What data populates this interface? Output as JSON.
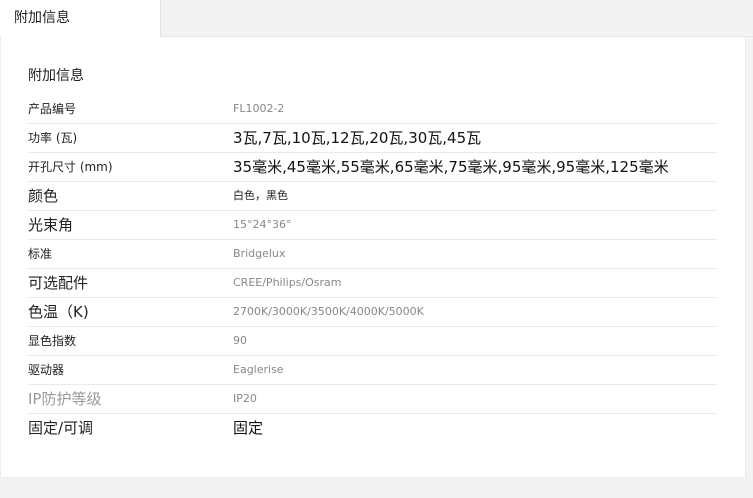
{
  "tab": {
    "label": "附加信息"
  },
  "section": {
    "title": "附加信息"
  },
  "specs": [
    {
      "label": "产品编号",
      "value": "FL1002-2"
    },
    {
      "label": "功率 (瓦)",
      "value": "3瓦,7瓦,10瓦,12瓦,20瓦,30瓦,45瓦"
    },
    {
      "label": "开孔尺寸 (mm)",
      "value": "35毫米,45毫米,55毫米,65毫米,75毫米,95毫米,95毫米,125毫米"
    },
    {
      "label": "颜色",
      "value": "白色，黑色"
    },
    {
      "label": "光束角",
      "value": "15°24°36°"
    },
    {
      "label": "标准",
      "value": "Bridgelux"
    },
    {
      "label": "可选配件",
      "value": "CREE/Philips/Osram"
    },
    {
      "label": "色温（K)",
      "value": "2700K/3000K/3500K/4000K/5000K"
    },
    {
      "label": "显色指数",
      "value": "90"
    },
    {
      "label": "驱动器",
      "value": "Eaglerise"
    },
    {
      "label": "IP防护等级",
      "value": "IP20"
    },
    {
      "label": "固定/可调",
      "value": "固定"
    }
  ]
}
